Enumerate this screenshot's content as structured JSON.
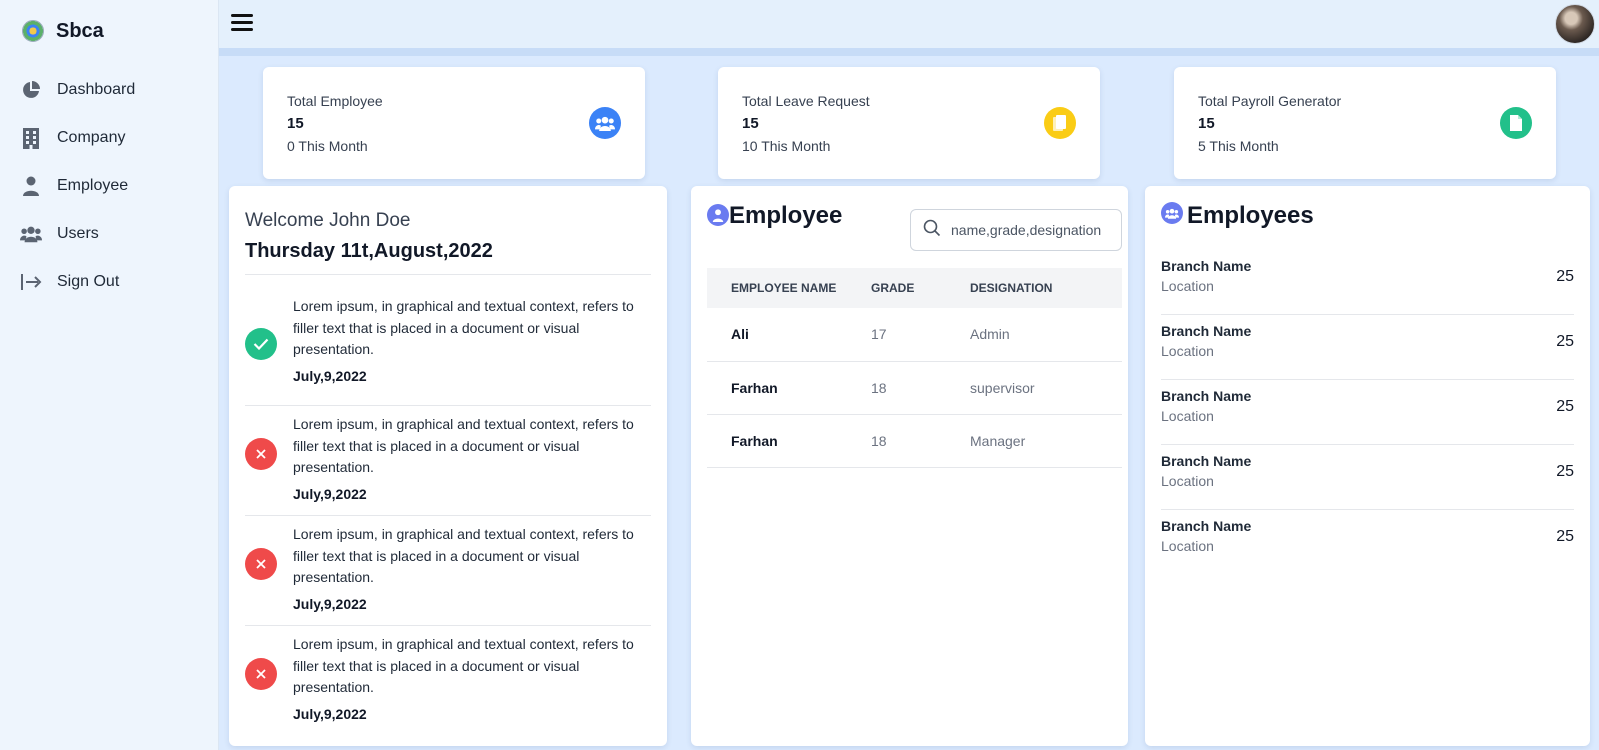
{
  "brand": {
    "name": "Sbca",
    "logo_icon": "logo-emblem-icon"
  },
  "sidebar": {
    "items": [
      {
        "label": "Dashboard",
        "icon": "pie-chart-icon"
      },
      {
        "label": "Company",
        "icon": "building-icon"
      },
      {
        "label": "Employee",
        "icon": "user-icon"
      },
      {
        "label": "Users",
        "icon": "users-icon"
      },
      {
        "label": "Sign Out",
        "icon": "sign-out-icon"
      }
    ]
  },
  "stats": [
    {
      "title": "Total Employee",
      "value": "15",
      "sub": "0 This Month",
      "icon": "users-icon",
      "color": "#3b82f6"
    },
    {
      "title": "Total Leave Request",
      "value": "15",
      "sub": "10 This Month",
      "icon": "copy-icon",
      "color": "#facc15"
    },
    {
      "title": "Total Payroll Generator",
      "value": "15",
      "sub": "5 This Month",
      "icon": "file-icon",
      "color": "#22c08a"
    }
  ],
  "welcome": {
    "title": "Welcome John Doe",
    "date": "Thursday 11t,August,2022",
    "feed": [
      {
        "status": "success",
        "text": "Lorem ipsum, in graphical and textual context, refers to filler text that is placed in a document or visual presentation.",
        "date": "July,9,2022"
      },
      {
        "status": "error",
        "text": "Lorem ipsum, in graphical and textual context, refers to filler text that is placed in a document or visual presentation.",
        "date": "July,9,2022"
      },
      {
        "status": "error",
        "text": "Lorem ipsum, in graphical and textual context, refers to filler text that is placed in a document or visual presentation.",
        "date": "July,9,2022"
      },
      {
        "status": "error",
        "text": "Lorem ipsum, in graphical and textual context, refers to filler text that is placed in a document or visual presentation.",
        "date": "July,9,2022"
      }
    ]
  },
  "employee_panel": {
    "heading": "Employee",
    "search": {
      "placeholder": "name,grade,designation"
    },
    "columns": [
      "EMPLOYEE NAME",
      "GRADE",
      "DESIGNATION"
    ],
    "rows": [
      {
        "name": "Ali",
        "grade": "17",
        "designation": "Admin"
      },
      {
        "name": "Farhan",
        "grade": "18",
        "designation": "supervisor"
      },
      {
        "name": "Farhan",
        "grade": "18",
        "designation": "Manager"
      }
    ]
  },
  "branches_panel": {
    "heading": "Employees",
    "rows": [
      {
        "name": "Branch Name",
        "location": "Location",
        "count": "25"
      },
      {
        "name": "Branch Name",
        "location": "Location",
        "count": "25"
      },
      {
        "name": "Branch Name",
        "location": "Location",
        "count": "25"
      },
      {
        "name": "Branch Name",
        "location": "Location",
        "count": "25"
      },
      {
        "name": "Branch Name",
        "location": "Location",
        "count": "25"
      }
    ]
  }
}
